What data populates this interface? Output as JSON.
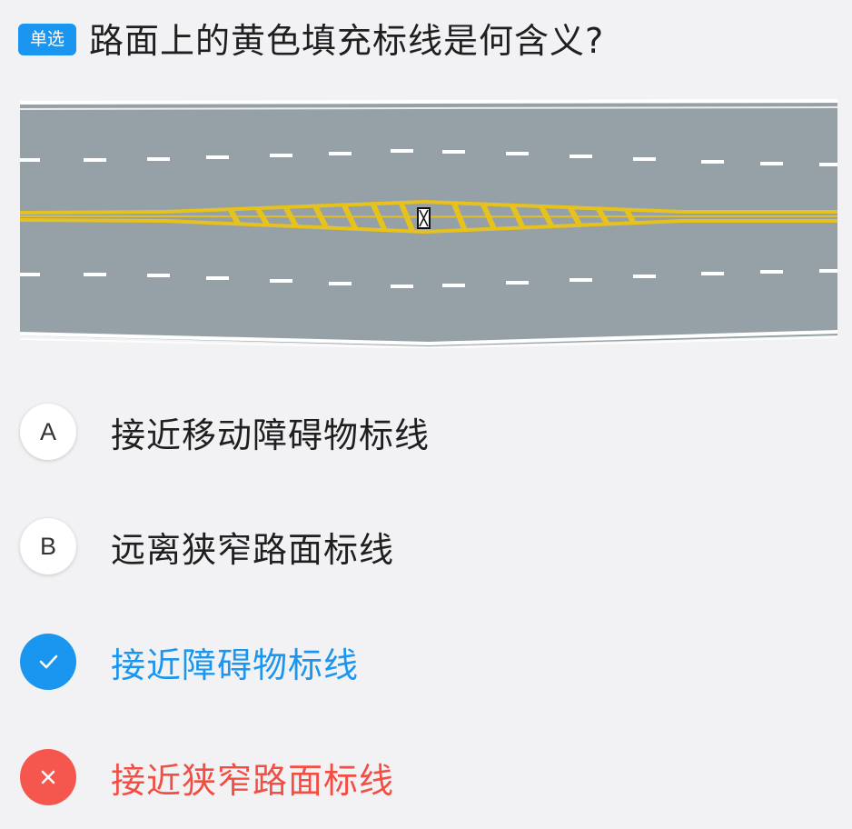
{
  "header": {
    "badge_label": "单选",
    "question": "路面上的黄色填充标线是何含义?"
  },
  "figure": {
    "road_color": "#95a1a7",
    "edge_line_color": "#ffffff",
    "center_line_color": "#e8c21c"
  },
  "options": [
    {
      "key": "A",
      "text": "接近移动障碍物标线",
      "state": "normal"
    },
    {
      "key": "B",
      "text": "远离狭窄路面标线",
      "state": "normal"
    },
    {
      "key": "",
      "text": "接近障碍物标线",
      "state": "correct",
      "icon": "check-icon"
    },
    {
      "key": "",
      "text": "接近狭窄路面标线",
      "state": "wrong",
      "icon": "close-icon"
    }
  ],
  "colors": {
    "accent": "#1a96f0",
    "error": "#f5574f"
  }
}
